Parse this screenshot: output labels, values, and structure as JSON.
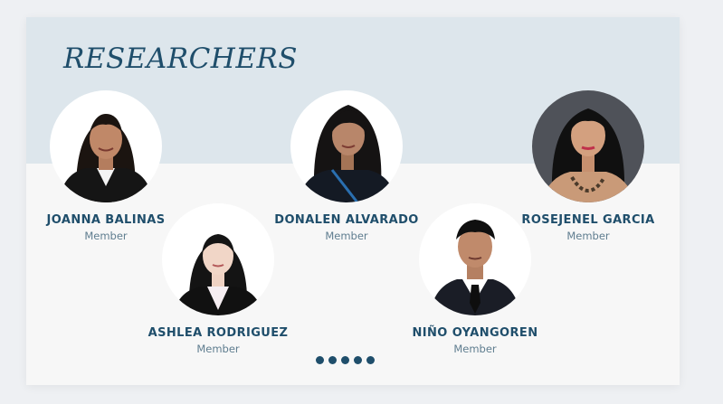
{
  "section": {
    "title": "RESEARCHERS"
  },
  "researchers": [
    {
      "name": "JOANNA BALINAS",
      "role": "Member"
    },
    {
      "name": "ASHLEA RODRIGUEZ",
      "role": "Member"
    },
    {
      "name": "DONALEN ALVARADO",
      "role": "Member"
    },
    {
      "name": "NIÑO OYANGOREN",
      "role": "Member"
    },
    {
      "name": "ROSEJENEL GARCIA",
      "role": "Member"
    }
  ],
  "carousel": {
    "dot_count": 5
  },
  "colors": {
    "accent": "#1f4e6b",
    "banner": "#dde6ec",
    "card": "#f7f7f7"
  }
}
